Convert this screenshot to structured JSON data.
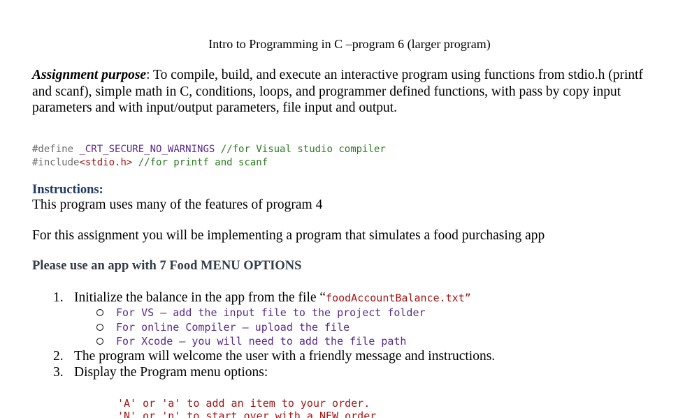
{
  "title": "Intro to Programming in C –program 6 (larger program)",
  "purpose": {
    "label": "Assignment purpose",
    "text": ": To compile, build, and execute an interactive program using functions from stdio.h (printf and scanf), simple math in C, conditions, loops, and programmer defined functions, with pass by copy input parameters and with input/output parameters, file input and output."
  },
  "code": {
    "line1_directive": "#define",
    "line1_ident": "_CRT_SECURE_NO_WARNINGS",
    "line1_comment": "//for Visual studio compiler",
    "line2_directive": "#include",
    "line2_header": "<stdio.h>",
    "line2_comment": "//for printf and scanf"
  },
  "instructions": {
    "heading": "Instructions:",
    "line1": "This program uses many of the features of program 4",
    "line2": "For this assignment you will be implementing a program that simulates a food purchasing app",
    "subheading": "Please use an app with 7 Food MENU OPTIONS"
  },
  "list": {
    "item1_num": "1.",
    "item1_text": "Initialize the balance in the app from the file “",
    "item1_file": "foodAccountBalance.txt”",
    "sub1": "For VS – add the input file to the project folder",
    "sub2": "For online Compiler – upload the file",
    "sub3": "For Xcode – you will need to add the file path",
    "item2_num": "2.",
    "item2_text": "The program will welcome the user with a friendly message and instructions.",
    "item3_num": "3.",
    "item3_text": "Display the Program menu options:"
  },
  "menu": {
    "line1": "'A' or 'a' to add an item to your order.",
    "line2": "'N' or 'n' to start over with a NEW order"
  }
}
